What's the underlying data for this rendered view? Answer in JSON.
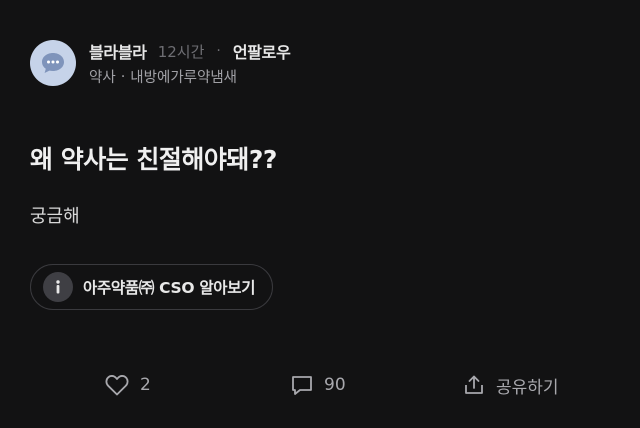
{
  "post": {
    "author": "블라블라",
    "time": "12시간",
    "separator": "·",
    "follow_label": "언팔로우",
    "category": "약사",
    "meta_separator": "·",
    "subcategory": "내방에가루약냄새",
    "title": "왜 약사는 친절해야돼??",
    "body": "궁금해"
  },
  "ad": {
    "label": "아주약품㈜ CSO 알아보기",
    "icon": "info-icon"
  },
  "actions": {
    "like_count": "2",
    "comment_count": "90",
    "share_label": "공유하기"
  },
  "colors": {
    "background": "#121213",
    "avatar_bg": "#c6d3e9",
    "avatar_glyph": "#7f94bb",
    "muted_text": "#6e6e73"
  }
}
